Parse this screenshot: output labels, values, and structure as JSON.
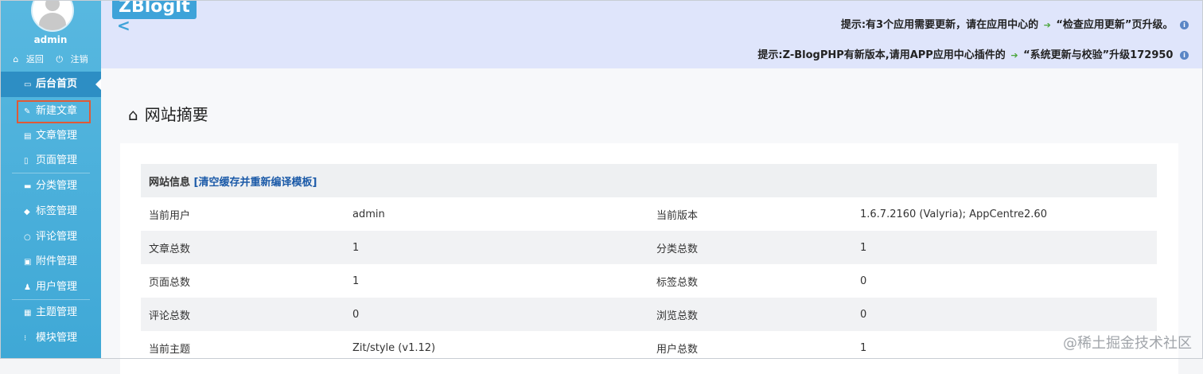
{
  "sidebar": {
    "username": "admin",
    "back_label": "返回",
    "logout_label": "注销",
    "items": [
      {
        "label": "后台首页",
        "icon": "monitor-icon"
      },
      {
        "label": "新建文章",
        "icon": "edit-icon"
      },
      {
        "label": "文章管理",
        "icon": "document-icon"
      },
      {
        "label": "页面管理",
        "icon": "page-icon"
      },
      {
        "label": "分类管理",
        "icon": "folder-icon"
      },
      {
        "label": "标签管理",
        "icon": "tag-icon"
      },
      {
        "label": "评论管理",
        "icon": "comment-icon"
      },
      {
        "label": "附件管理",
        "icon": "attachment-icon"
      },
      {
        "label": "用户管理",
        "icon": "user-icon"
      },
      {
        "label": "主题管理",
        "icon": "theme-icon"
      },
      {
        "label": "模块管理",
        "icon": "module-icon"
      }
    ]
  },
  "header": {
    "logo": "ZBlogIt",
    "notice1_pre": "提示:有3个应用需要更新，请在应用中心的",
    "notice1_link": "“检查应用更新”页升级。",
    "notice2_pre": "提示:Z-BlogPHP有新版本,请用APP应用中心插件的",
    "notice2_link": "“系统更新与校验”升级172950"
  },
  "main": {
    "title": "网站摘要",
    "table_header": "网站信息",
    "table_header_link": "[清空缓存并重新编译模板]",
    "rows": [
      {
        "k1": "当前用户",
        "v1": "admin",
        "k2": "当前版本",
        "v2": "1.6.7.2160 (Valyria); AppCentre2.60"
      },
      {
        "k1": "文章总数",
        "v1": "1",
        "k2": "分类总数",
        "v2": "1"
      },
      {
        "k1": "页面总数",
        "v1": "1",
        "k2": "标签总数",
        "v2": "0"
      },
      {
        "k1": "评论总数",
        "v1": "0",
        "k2": "浏览总数",
        "v2": "0"
      },
      {
        "k1": "当前主题",
        "v1": "Zit/style (v1.12)",
        "k2": "用户总数",
        "v2": "1"
      }
    ]
  },
  "watermark": "@稀土掘金技术社区",
  "colors": {
    "sidebar": "#3fa8d6",
    "header": "#dfe5fb",
    "highlight": "#e05a36",
    "link": "#1b5aa8"
  }
}
